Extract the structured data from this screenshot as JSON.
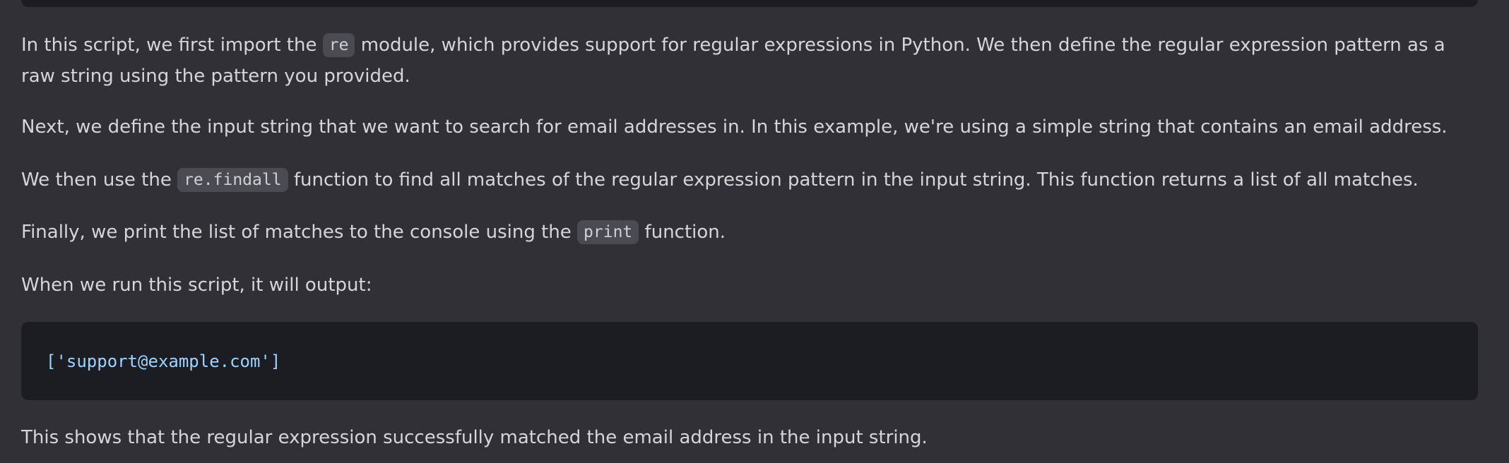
{
  "paragraphs": {
    "p1": {
      "before": "In this script, we first import the ",
      "code": "re",
      "after": " module, which provides support for regular expressions in Python. We then define the regular expression pattern as a raw string using the pattern you provided."
    },
    "p2": {
      "text": "Next, we define the input string that we want to search for email addresses in. In this example, we're using a simple string that contains an email address."
    },
    "p3": {
      "before": "We then use the ",
      "code": "re.findall",
      "after": " function to find all matches of the regular expression pattern in the input string. This function returns a list of all matches."
    },
    "p4": {
      "before": "Finally, we print the list of matches to the console using the ",
      "code": "print",
      "after": " function."
    },
    "p5": {
      "text": "When we run this script, it will output:"
    },
    "p6": {
      "text": "This shows that the regular expression successfully matched the email address in the input string."
    }
  },
  "output_block": {
    "line": "['support@example.com']"
  },
  "colors": {
    "background": "#313036",
    "text": "#d6d6d8",
    "code_block_background": "#1b1d23",
    "inline_code_background": "#4a4b52",
    "code_text": "#9fd3ff"
  }
}
